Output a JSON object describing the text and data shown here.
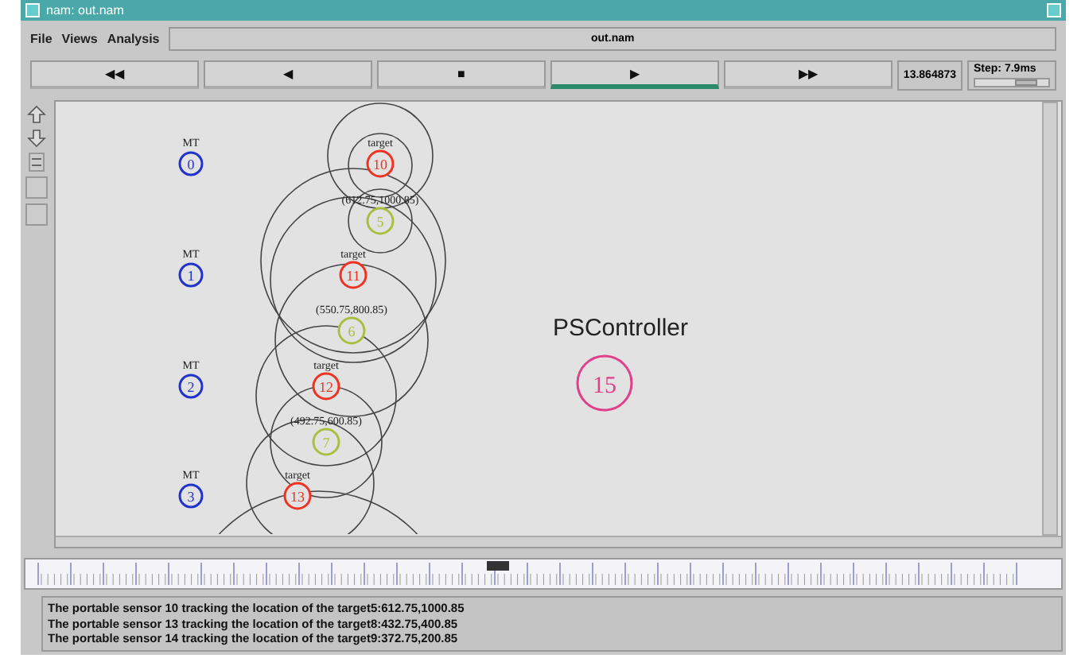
{
  "window": {
    "title": "nam: out.nam"
  },
  "menu": [
    {
      "label": "File"
    },
    {
      "label": "Views"
    },
    {
      "label": "Analysis"
    }
  ],
  "file_name": "out.nam",
  "transport": [
    {
      "label": "◀◀",
      "selected": false
    },
    {
      "label": "◀",
      "selected": false
    },
    {
      "label": "■",
      "selected": false
    },
    {
      "label": "▶",
      "selected": true
    },
    {
      "label": "▶▶",
      "selected": false
    }
  ],
  "time": "13.864873",
  "step": {
    "label": "Step: 7.9ms",
    "level": 0.7
  },
  "canvas": {
    "nodes": [
      {
        "id": "0",
        "caption": "MT",
        "color": "#2233cc"
      },
      {
        "id": "1",
        "caption": "MT",
        "color": "#2233cc"
      },
      {
        "id": "2",
        "caption": "MT",
        "color": "#2233cc"
      },
      {
        "id": "3",
        "caption": "MT",
        "color": "#2233cc"
      },
      {
        "id": "10",
        "caption": "target",
        "color": "#ee3322"
      },
      {
        "id": "5",
        "caption": "(612.75,1000.85)",
        "color": "#a8c040"
      },
      {
        "id": "11",
        "caption": "target",
        "color": "#ee3322"
      },
      {
        "id": "6",
        "caption": "(550.75,800.85)",
        "color": "#a8c040"
      },
      {
        "id": "12",
        "caption": "target",
        "color": "#ee3322"
      },
      {
        "id": "7",
        "caption": "(492.75,600.85)",
        "color": "#a8c040"
      },
      {
        "id": "13",
        "caption": "target",
        "color": "#ee3322"
      },
      {
        "id": "15",
        "caption": "PSController",
        "color": "#e0408a"
      }
    ]
  },
  "log": [
    "The portable sensor 10 tracking the location of the target5:612.75,1000.85",
    "The portable sensor 13 tracking the location of the target8:432.75,400.85",
    "The portable sensor 14 tracking the location of the target9:372.75,200.85"
  ]
}
